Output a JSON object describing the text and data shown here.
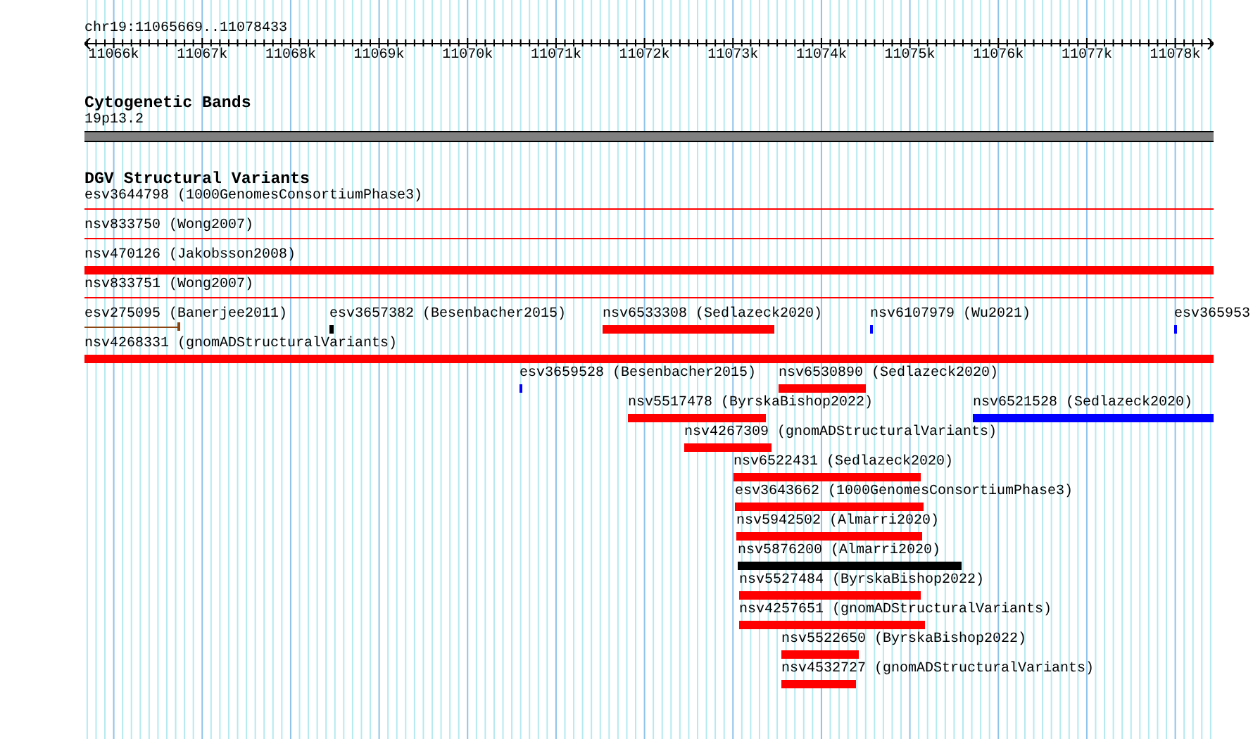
{
  "region": "chr19:11065669..11078433",
  "scale": {
    "ticks": [
      "11066k",
      "11067k",
      "11068k",
      "11069k",
      "11070k",
      "11071k",
      "11072k",
      "11073k",
      "11074k",
      "11075k",
      "11076k",
      "11077k",
      "11078k"
    ]
  },
  "cytoband_track": {
    "title": "Cytogenetic Bands",
    "band": {
      "label": "19p13.2"
    }
  },
  "dgv_track": {
    "title": "DGV Structural Variants",
    "rows": [
      {
        "features": [
          {
            "label": "esv3644798 (1000GenomesConsortiumPhase3)",
            "kind": "line",
            "color": "#ff0000"
          }
        ]
      },
      {
        "features": [
          {
            "label": "nsv833750 (Wong2007)",
            "kind": "line",
            "color": "#ff0000"
          }
        ]
      },
      {
        "features": [
          {
            "label": "nsv470126 (Jakobsson2008)",
            "kind": "bar",
            "color": "#ff0000"
          }
        ]
      },
      {
        "features": [
          {
            "label": "nsv833751 (Wong2007)",
            "kind": "line",
            "color": "#ff0000"
          }
        ]
      },
      {
        "features": [
          {
            "label": "esv275095 (Banerjee2011)",
            "kind": "line",
            "color": "#8b4513"
          },
          {
            "label": "esv3657382 (Besenbacher2015)",
            "kind": "bar",
            "color": "#000000"
          },
          {
            "label": "nsv6533308 (Sedlazeck2020)",
            "kind": "bar",
            "color": "#ff0000"
          },
          {
            "label": "nsv6107979 (Wu2021)",
            "kind": "bar",
            "color": "#0000ff"
          },
          {
            "label": "esv365953",
            "kind": "bar",
            "color": "#0000ff"
          }
        ]
      },
      {
        "features": [
          {
            "label": "nsv4268331 (gnomADStructuralVariants)",
            "kind": "bar",
            "color": "#ff0000"
          }
        ]
      },
      {
        "features": [
          {
            "label": "esv3659528 (Besenbacher2015)",
            "kind": "bar",
            "color": "#0000ff"
          },
          {
            "label": "nsv6530890 (Sedlazeck2020)",
            "kind": "bar",
            "color": "#ff0000"
          }
        ]
      },
      {
        "features": [
          {
            "label": "nsv5517478 (ByrskaBishop2022)",
            "kind": "bar",
            "color": "#ff0000"
          },
          {
            "label": "nsv6521528 (Sedlazeck2020)",
            "kind": "bar",
            "color": "#0000ff"
          }
        ]
      },
      {
        "features": [
          {
            "label": "nsv4267309 (gnomADStructuralVariants)",
            "kind": "bar",
            "color": "#ff0000"
          }
        ]
      },
      {
        "features": [
          {
            "label": "nsv6522431 (Sedlazeck2020)",
            "kind": "bar",
            "color": "#ff0000"
          }
        ]
      },
      {
        "features": [
          {
            "label": "esv3643662 (1000GenomesConsortiumPhase3)",
            "kind": "bar",
            "color": "#ff0000"
          }
        ]
      },
      {
        "features": [
          {
            "label": "nsv5942502 (Almarri2020)",
            "kind": "bar",
            "color": "#ff0000"
          }
        ]
      },
      {
        "features": [
          {
            "label": "nsv5876200 (Almarri2020)",
            "kind": "bar",
            "color": "#000000"
          }
        ]
      },
      {
        "features": [
          {
            "label": "nsv5527484 (ByrskaBishop2022)",
            "kind": "bar",
            "color": "#ff0000"
          }
        ]
      },
      {
        "features": [
          {
            "label": "nsv4257651 (gnomADStructuralVariants)",
            "kind": "bar",
            "color": "#ff0000"
          }
        ]
      },
      {
        "features": [
          {
            "label": "nsv5522650 (ByrskaBishop2022)",
            "kind": "bar",
            "color": "#ff0000"
          }
        ]
      },
      {
        "features": [
          {
            "label": "nsv4532727 (gnomADStructuralVariants)",
            "kind": "bar",
            "color": "#ff0000"
          }
        ]
      }
    ]
  }
}
